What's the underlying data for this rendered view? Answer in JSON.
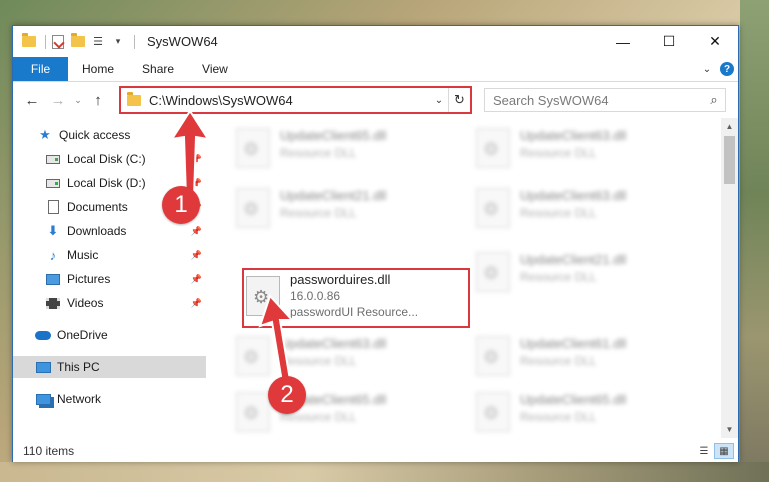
{
  "window": {
    "title": "SysWOW64",
    "controls": {
      "minimize": "—",
      "maximize": "☐",
      "close": "✕"
    }
  },
  "ribbon": {
    "file_tab": "File",
    "tabs": [
      "Home",
      "Share",
      "View"
    ],
    "help": "?"
  },
  "address": {
    "path": "C:\\Windows\\SysWOW64",
    "dropdown": "⌄",
    "refresh": "↻"
  },
  "search": {
    "placeholder": "Search SysWOW64"
  },
  "nav": {
    "back": "←",
    "forward": "→",
    "recent": "⌄",
    "up": "↑"
  },
  "sidebar": {
    "items": [
      {
        "label": "Quick access",
        "icon": "star-icon",
        "pinned": false
      },
      {
        "label": "Local Disk (C:)",
        "icon": "drive-icon",
        "pinned": true
      },
      {
        "label": "Local Disk (D:)",
        "icon": "drive-icon",
        "pinned": true
      },
      {
        "label": "Documents",
        "icon": "document-icon",
        "pinned": true
      },
      {
        "label": "Downloads",
        "icon": "download-icon",
        "pinned": true
      },
      {
        "label": "Music",
        "icon": "music-icon",
        "pinned": true
      },
      {
        "label": "Pictures",
        "icon": "pictures-icon",
        "pinned": true
      },
      {
        "label": "Videos",
        "icon": "videos-icon",
        "pinned": true
      },
      {
        "label": "OneDrive",
        "icon": "onedrive-icon",
        "pinned": false
      },
      {
        "label": "This PC",
        "icon": "this-pc-icon",
        "pinned": false,
        "selected": true
      },
      {
        "label": "Network",
        "icon": "network-icon",
        "pinned": false
      }
    ]
  },
  "files": {
    "left": [
      {
        "name": "UpdateClient65.dll",
        "sub": "Resource DLL"
      },
      {
        "name": "UpdateClient21.dll",
        "sub": "Resource DLL"
      },
      {
        "name": "passworduires.dll",
        "version": "16.0.0.86",
        "sub": "passwordUI Resource..."
      },
      {
        "name": "UpdateClient63.dll",
        "sub": "Resource DLL"
      },
      {
        "name": "UpdateClient65.dll",
        "sub": "Resource DLL"
      }
    ],
    "right": [
      {
        "name": "UpdateClient63.dll",
        "sub": "Resource DLL"
      },
      {
        "name": "UpdateClient63.dll",
        "sub": "Resource DLL"
      },
      {
        "name": "UpdateClient21.dll",
        "sub": "Resource DLL"
      },
      {
        "name": "UpdateClient61.dll",
        "sub": "Resource DLL"
      },
      {
        "name": "UpdateClient65.dll",
        "sub": "Resource DLL"
      }
    ]
  },
  "status": {
    "count": "110 items"
  },
  "annotations": {
    "step1": "1",
    "step2": "2",
    "color": "#e0393c"
  },
  "colors": {
    "accent": "#1979ca",
    "highlight": "#d9383e"
  }
}
